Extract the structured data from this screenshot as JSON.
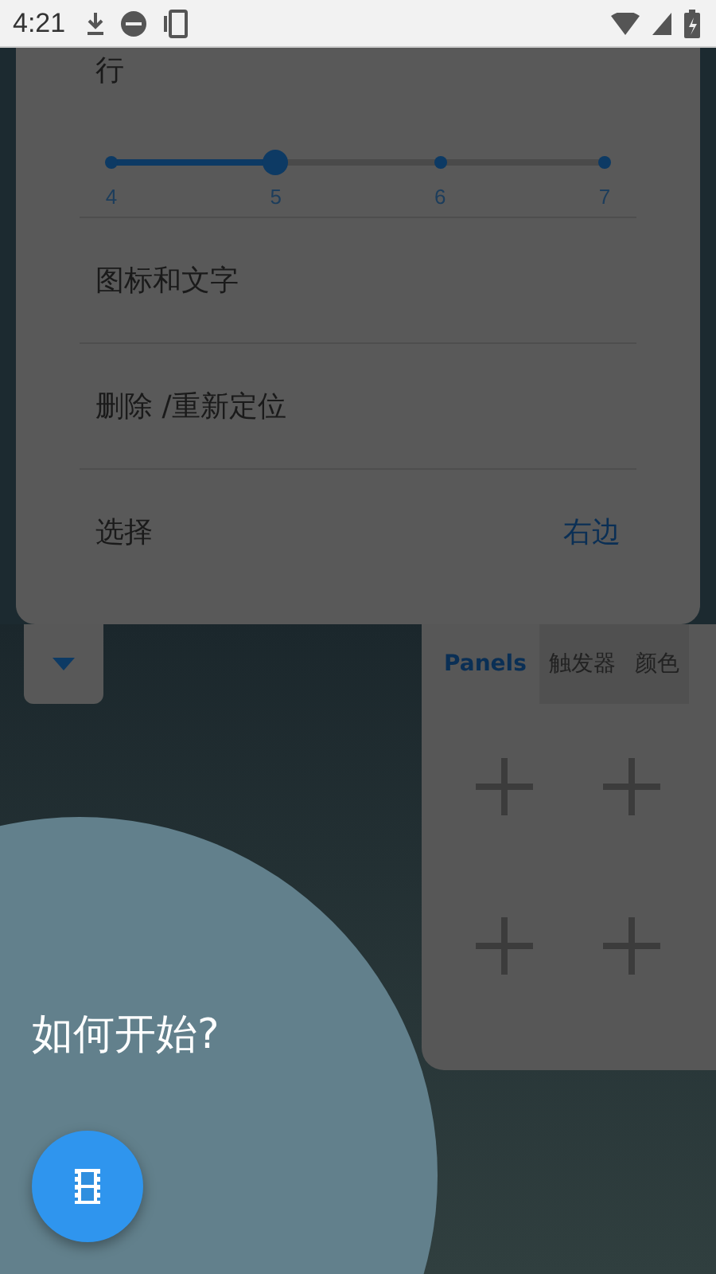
{
  "status_bar": {
    "time": "4:21"
  },
  "settings_card": {
    "slider": {
      "label": "行",
      "level": 0.3333,
      "ticks": [
        "4",
        "5",
        "6",
        "7"
      ]
    },
    "items": [
      {
        "kind": "plain",
        "label": "图标和文字"
      },
      {
        "kind": "plain",
        "label": "删除 /重新定位"
      },
      {
        "kind": "value",
        "label": "选择",
        "value": "右边"
      }
    ]
  },
  "panel": {
    "tabs": [
      {
        "label": "Panels",
        "selected": true
      },
      {
        "label": "触发器",
        "selected": false
      },
      {
        "label": "颜色",
        "selected": false
      }
    ],
    "slots": [
      {
        "kind": "add"
      },
      {
        "kind": "add"
      },
      {
        "kind": "add"
      },
      {
        "kind": "add"
      }
    ]
  },
  "intro": {
    "heading": "如何开始?"
  }
}
